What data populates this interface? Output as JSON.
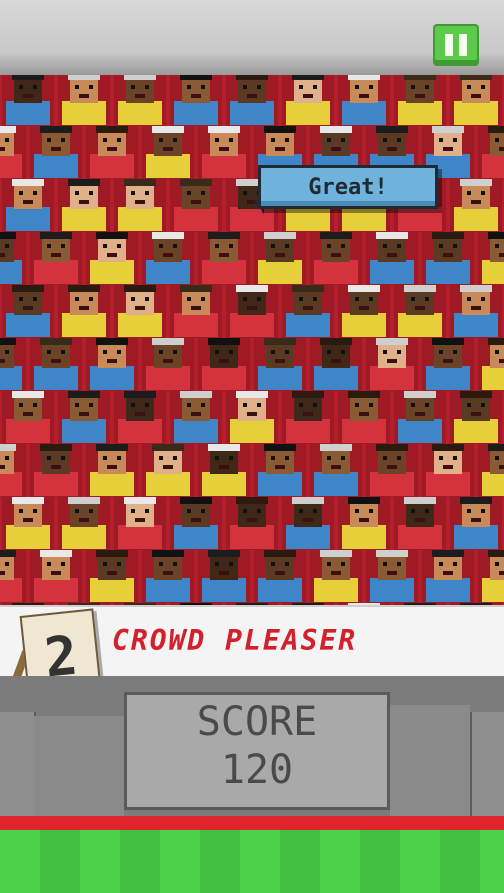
{
  "hud": {
    "pause_icon": "pause-icon"
  },
  "speech_bubble": {
    "text": "Great!"
  },
  "banner": {
    "combo_count": "2",
    "title": "CROWD PLEASER"
  },
  "scoreboard": {
    "label": "SCORE",
    "value": "120"
  },
  "colors": {
    "seat_red": "#b51f2b",
    "shirt_yellow": "#e7cf3a",
    "shirt_blue": "#3f86c9",
    "shirt_red": "#d4323c",
    "pause_green": "#5bc94a",
    "bubble_blue": "#6fb3dd",
    "grass_green": "#4cd14a"
  }
}
